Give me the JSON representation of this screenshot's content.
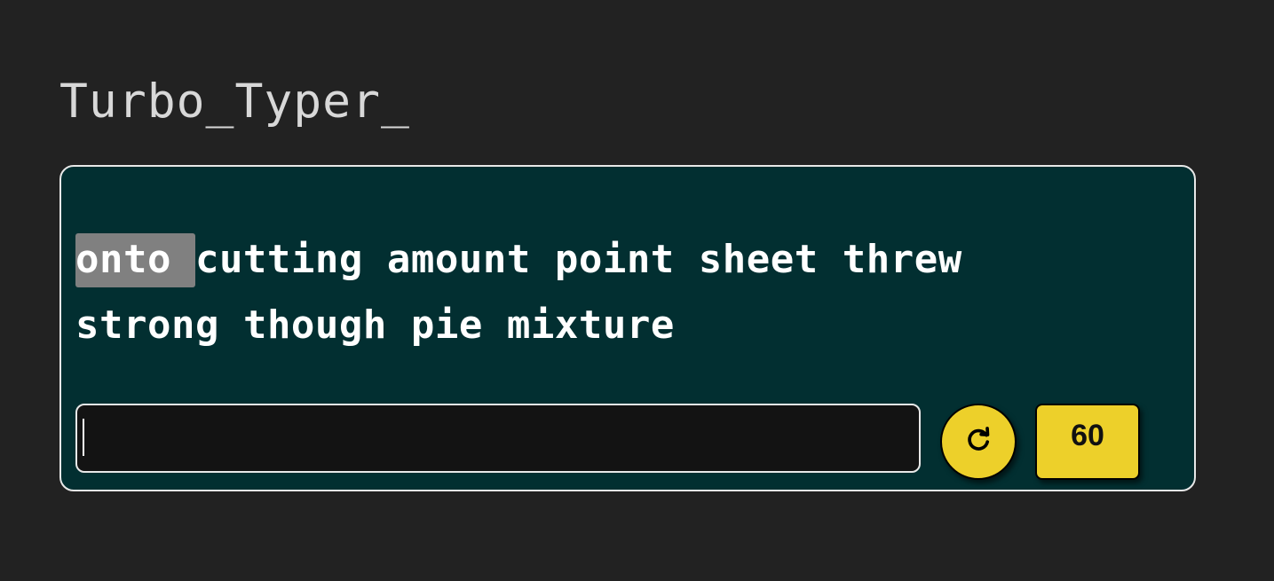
{
  "app": {
    "title": "Turbo_Typer_"
  },
  "test": {
    "words": [
      {
        "text": "onto",
        "current": true
      },
      {
        "text": "cutting",
        "current": false
      },
      {
        "text": "amount",
        "current": false
      },
      {
        "text": "point",
        "current": false
      },
      {
        "text": "sheet",
        "current": false
      },
      {
        "text": "threw",
        "current": false
      },
      {
        "text": "strong",
        "current": false
      },
      {
        "text": "though",
        "current": false
      },
      {
        "text": "pie",
        "current": false
      },
      {
        "text": "mixture",
        "current": false
      }
    ],
    "input_value": "",
    "timer": "60"
  },
  "icons": {
    "restart": "refresh-icon"
  },
  "colors": {
    "background": "#222222",
    "panel": "#022f31",
    "accent": "#edd02a",
    "current_word_highlight": "#808080",
    "input_background": "#131313"
  }
}
